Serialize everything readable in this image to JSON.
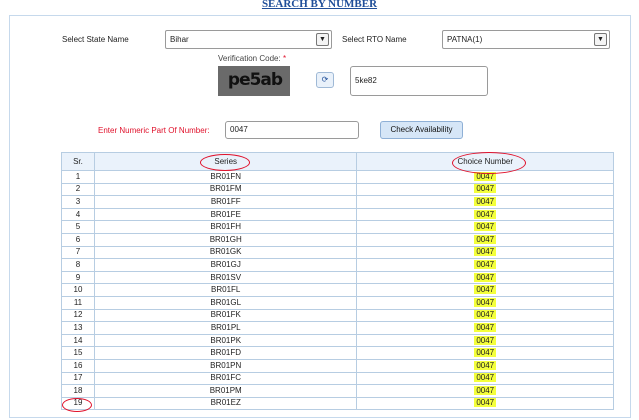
{
  "page": {
    "title": "SEARCH BY NUMBER"
  },
  "form": {
    "state_label": "Select State Name",
    "state_value": "Bihar",
    "rto_label": "Select RTO Name",
    "rto_value": "PATNA(1)",
    "verification_label": "Verification Code:",
    "required_mark": "*",
    "captcha_text": "pe5ab",
    "captcha_input_value": "5ke82",
    "number_label": "Enter Numeric Part Of Number:",
    "number_value": "0047",
    "check_button": "Check Availability"
  },
  "table": {
    "headers": [
      "Sr.",
      "Series",
      "Choice Number"
    ],
    "rows": [
      {
        "sr": "1",
        "series": "BR01FN",
        "choice": "0047"
      },
      {
        "sr": "2",
        "series": "BR01FM",
        "choice": "0047"
      },
      {
        "sr": "3",
        "series": "BR01FF",
        "choice": "0047"
      },
      {
        "sr": "4",
        "series": "BR01FE",
        "choice": "0047"
      },
      {
        "sr": "5",
        "series": "BR01FH",
        "choice": "0047"
      },
      {
        "sr": "6",
        "series": "BR01GH",
        "choice": "0047"
      },
      {
        "sr": "7",
        "series": "BR01GK",
        "choice": "0047"
      },
      {
        "sr": "8",
        "series": "BR01GJ",
        "choice": "0047"
      },
      {
        "sr": "9",
        "series": "BR01SV",
        "choice": "0047"
      },
      {
        "sr": "10",
        "series": "BR01FL",
        "choice": "0047"
      },
      {
        "sr": "11",
        "series": "BR01GL",
        "choice": "0047"
      },
      {
        "sr": "12",
        "series": "BR01FK",
        "choice": "0047"
      },
      {
        "sr": "13",
        "series": "BR01PL",
        "choice": "0047"
      },
      {
        "sr": "14",
        "series": "BR01PK",
        "choice": "0047"
      },
      {
        "sr": "15",
        "series": "BR01FD",
        "choice": "0047"
      },
      {
        "sr": "16",
        "series": "BR01PN",
        "choice": "0047"
      },
      {
        "sr": "17",
        "series": "BR01FC",
        "choice": "0047"
      },
      {
        "sr": "18",
        "series": "BR01PM",
        "choice": "0047"
      },
      {
        "sr": "19",
        "series": "BR01EZ",
        "choice": "0047"
      }
    ]
  },
  "colors": {
    "title": "#1f4e99",
    "required_label": "#e0112b",
    "annotation": "#e0112b",
    "highlight": "#f4ff3c"
  }
}
